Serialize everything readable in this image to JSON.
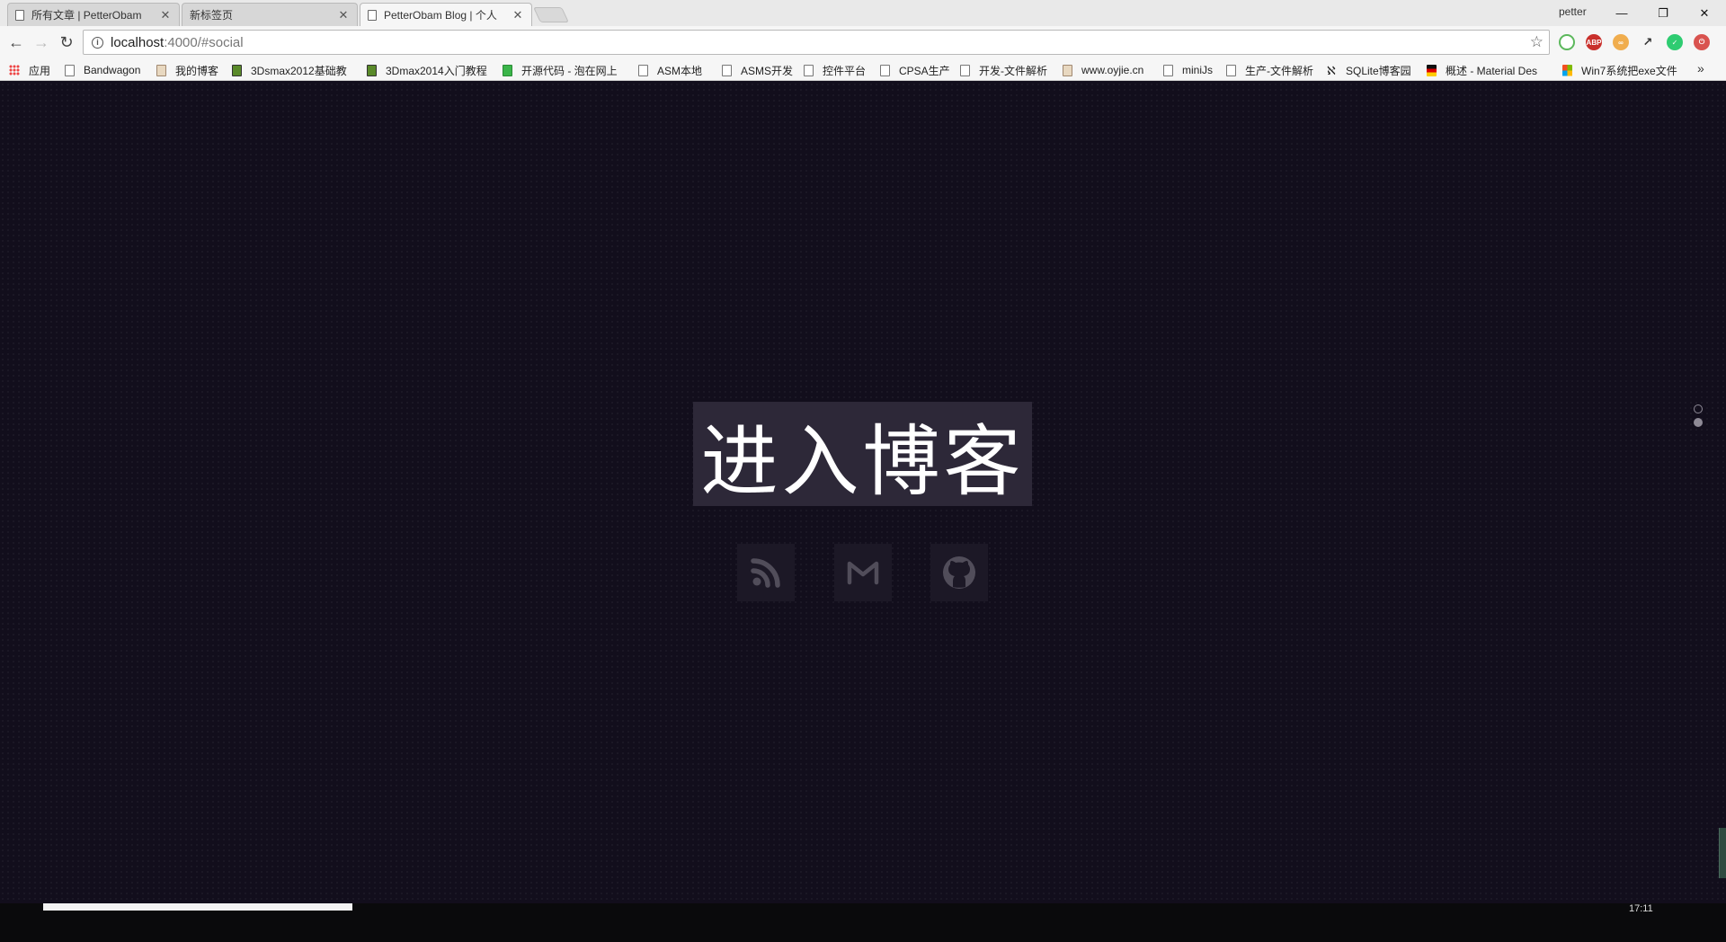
{
  "browser": {
    "tabs": [
      {
        "title": "所有文章 | PetterObam",
        "active": false
      },
      {
        "title": "新标签页",
        "active": false
      },
      {
        "title": "PetterObam Blog | 个人",
        "active": true
      }
    ],
    "profile": "petter",
    "url_host": "localhost",
    "url_path": ":4000/#social"
  },
  "bookmarks": [
    {
      "label": "应用",
      "icon": "apps-icon"
    },
    {
      "label": "Bandwagon",
      "icon": "page-icon"
    },
    {
      "label": "我的博客",
      "icon": "chess-icon"
    },
    {
      "label": "3Dsmax2012基础教",
      "icon": "vray-icon"
    },
    {
      "label": "3Dmax2014入门教程",
      "icon": "vray-icon"
    },
    {
      "label": "开源代码 - 泡在网上",
      "icon": "j-icon"
    },
    {
      "label": "ASM本地",
      "icon": "page-icon"
    },
    {
      "label": "ASMS开发",
      "icon": "page-icon"
    },
    {
      "label": "控件平台",
      "icon": "page-icon"
    },
    {
      "label": "CPSA生产",
      "icon": "page-icon"
    },
    {
      "label": "开发-文件解析",
      "icon": "page-icon"
    },
    {
      "label": "www.oyjie.cn",
      "icon": "chess-icon"
    },
    {
      "label": "miniJs",
      "icon": "page-icon"
    },
    {
      "label": "生产-文件解析",
      "icon": "page-icon"
    },
    {
      "label": "SQLite博客园",
      "icon": "feather-icon"
    },
    {
      "label": "概述 - Material Des",
      "icon": "flag-icon"
    },
    {
      "label": "Win7系统把exe文件",
      "icon": "windows-icon"
    }
  ],
  "bookmarks_more": "»",
  "page": {
    "enter_button": "进入博客",
    "social_links": [
      {
        "name": "rss",
        "icon": "rss-icon"
      },
      {
        "name": "mail",
        "icon": "gmail-icon"
      },
      {
        "name": "github",
        "icon": "github-icon"
      }
    ],
    "section_dots": [
      {
        "active": false
      },
      {
        "active": true
      }
    ]
  },
  "taskbar": {
    "clock": "17:11"
  }
}
